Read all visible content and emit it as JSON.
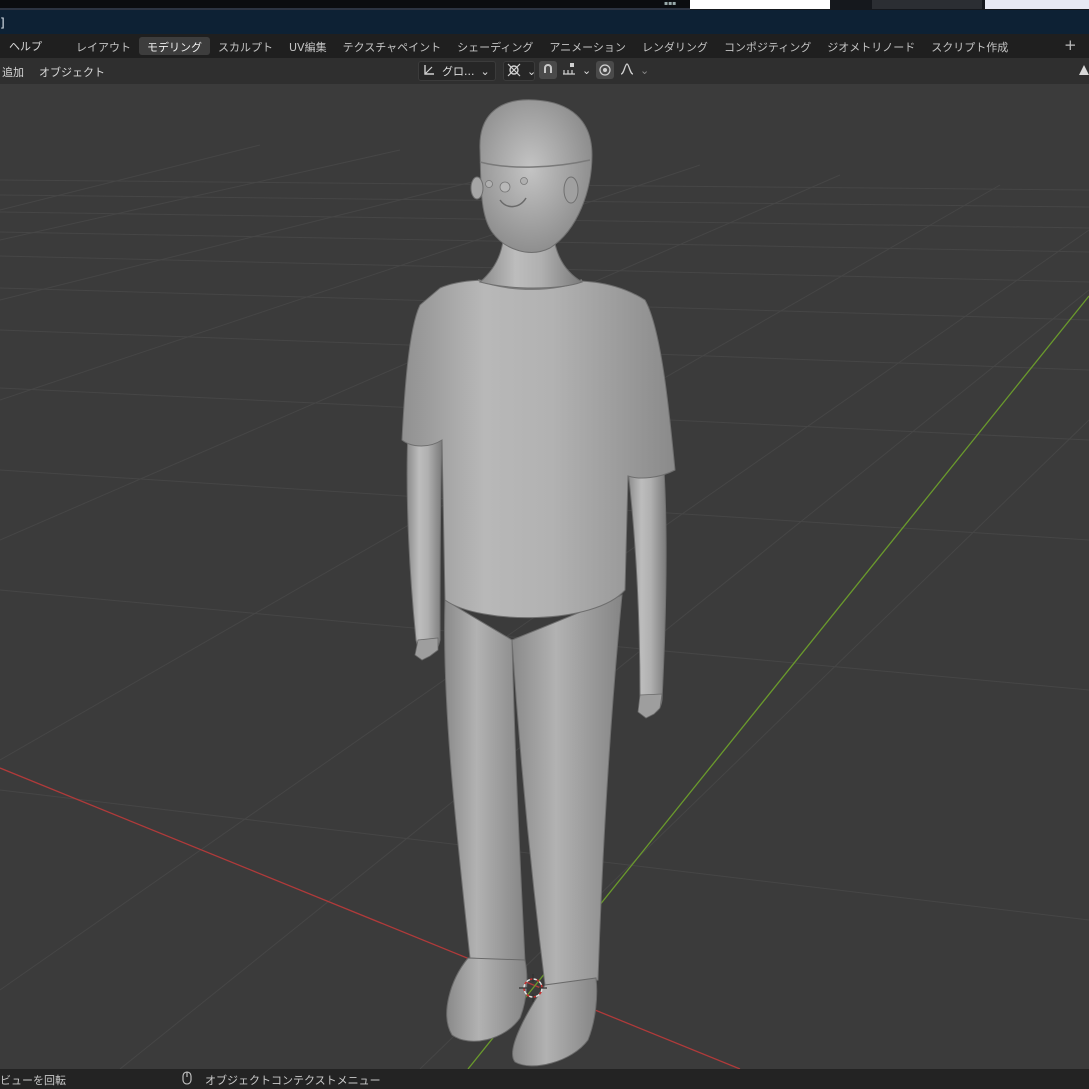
{
  "app": {
    "title_fragment": "]"
  },
  "menu": {
    "help_label": "ヘルプ",
    "tabs": [
      {
        "label": "レイアウト",
        "active": false
      },
      {
        "label": "モデリング",
        "active": true
      },
      {
        "label": "スカルプト",
        "active": false
      },
      {
        "label": "UV編集",
        "active": false
      },
      {
        "label": "テクスチャペイント",
        "active": false
      },
      {
        "label": "シェーディング",
        "active": false
      },
      {
        "label": "アニメーション",
        "active": false
      },
      {
        "label": "レンダリング",
        "active": false
      },
      {
        "label": "コンポジティング",
        "active": false
      },
      {
        "label": "ジオメトリノード",
        "active": false
      },
      {
        "label": "スクリプト作成",
        "active": false
      }
    ],
    "add_tab_symbol": "+"
  },
  "header": {
    "add_label": "追加",
    "object_label": "オブジェクト",
    "transform_orientation": "グロ...",
    "pivot_icon": "pivot-point-icon",
    "snap_icon": "magnet-icon",
    "snap_increment_icon": "snap-increment-icon",
    "proportional_icon": "proportional-edit-icon",
    "falloff_icon": "falloff-curve-icon",
    "dropdown_symbol": "⌄",
    "right_icon": "view-gizmo-icon"
  },
  "viewport": {
    "model": "humanoid-figure",
    "grid_color": "#4a4a4a",
    "x_axis_color": "#b03a3a",
    "y_axis_color": "#6a9a2c",
    "background": "#3b3b3b"
  },
  "status": {
    "rotate_view": "ビューを回転",
    "mouse_icon": "mouse-icon",
    "context_menu": "オブジェクトコンテクストメニュー"
  }
}
